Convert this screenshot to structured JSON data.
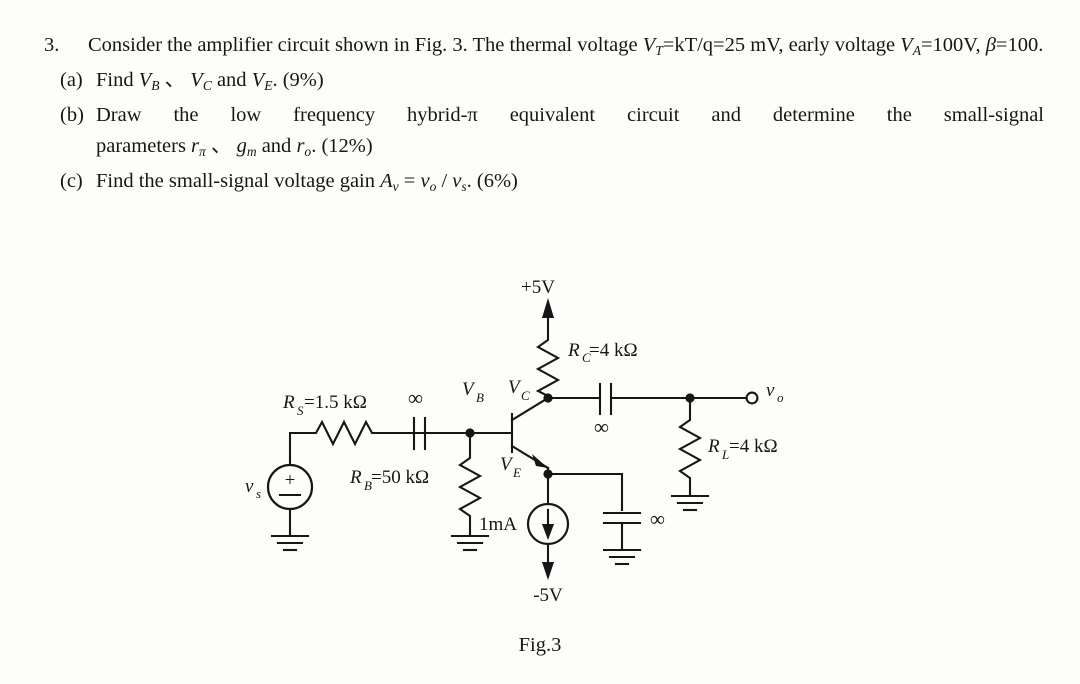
{
  "question": {
    "number": "3.",
    "stem_parts": {
      "p1": "Consider the amplifier circuit shown in Fig. 3. The thermal voltage ",
      "vt": "V",
      "vt_sub": "T",
      "p2": "=kT/q=25 mV, early voltage ",
      "va": "V",
      "va_sub": "A",
      "p3": "=100V, ",
      "beta": "β",
      "p4": "=100."
    },
    "parts": [
      {
        "label": "(a)",
        "text_parts": {
          "a1": "Find ",
          "v1": "V",
          "v1_sub": "B",
          "sep": " 、 ",
          "v2": "V",
          "v2_sub": "C",
          "a2": " and ",
          "v3": "V",
          "v3_sub": "E",
          "a3": ". (9%)"
        }
      },
      {
        "label": "(b)",
        "line1": "Draw the low frequency hybrid-π equivalent circuit and determine the small-signal",
        "line2_parts": {
          "b1": "parameters ",
          "r1": "r",
          "r1_sub": "π",
          "sep": " 、 ",
          "g1": "g",
          "g1_sub": "m",
          "b2": " and ",
          "r2": "r",
          "r2_sub": "o",
          "b3": ". (12%)"
        }
      },
      {
        "label": "(c)",
        "text_parts": {
          "c1": "Find the small-signal voltage gain ",
          "a": "A",
          "a_sub": "v",
          "c2": " = ",
          "vo": "v",
          "vo_sub": "o",
          "c3": " / ",
          "vs": "v",
          "vs_sub": "s",
          "c4": ". (6%)"
        }
      }
    ]
  },
  "figure": {
    "caption": "Fig.3",
    "supply_positive": "+5V",
    "supply_negative": "-5V",
    "components": {
      "rc": {
        "name": "R",
        "sub": "C",
        "value": "=4 kΩ"
      },
      "rs": {
        "name": "R",
        "sub": "S",
        "value": "=1.5 kΩ"
      },
      "rb": {
        "name": "R",
        "sub": "B",
        "value": "=50 kΩ"
      },
      "rl": {
        "name": "R",
        "sub": "L",
        "value": "=4 kΩ"
      },
      "current_source": "1mA",
      "cap_input": "∞",
      "cap_output": "∞",
      "cap_bypass": "∞"
    },
    "nodes": {
      "vb": {
        "name": "V",
        "sub": "B"
      },
      "vc": {
        "name": "V",
        "sub": "C"
      },
      "ve": {
        "name": "V",
        "sub": "E"
      },
      "vo": {
        "name": "v",
        "sub": "o"
      },
      "vs": {
        "name": "v",
        "sub": "s"
      }
    },
    "source_polarity": {
      "plus": "+",
      "minus": "−"
    }
  },
  "colors": {
    "ink": "#161616",
    "paper": "#fdfdfc"
  }
}
